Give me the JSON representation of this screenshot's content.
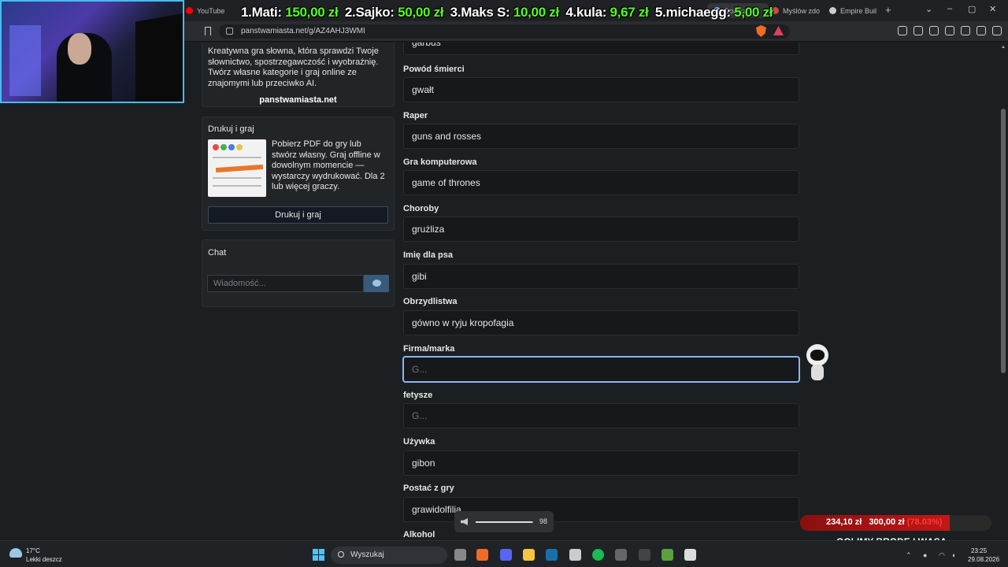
{
  "browser": {
    "tabs": [
      {
        "label": "YouTube",
        "color": "#ff0000"
      },
      {
        "label": "Dołącz",
        "color": "#8ab4f8"
      },
      {
        "label": "Myślów zdo",
        "color": "#c94b4b"
      },
      {
        "label": "Empire Buil",
        "color": "#cccccc"
      }
    ],
    "new_tab": "+",
    "url": "panstwamiasta.net/g/AZ4AHJ3WMI"
  },
  "donors": [
    {
      "rank": "1.",
      "name": "Mati:",
      "amount": "150,00 zł"
    },
    {
      "rank": "2.",
      "name": "Sajko:",
      "amount": "50,00 zł"
    },
    {
      "rank": "3.",
      "name": "Maks S:",
      "amount": "10,00 zł"
    },
    {
      "rank": "4.",
      "name": "kula:",
      "amount": "9,67 zł"
    },
    {
      "rank": "5.",
      "name": "michaegg:",
      "amount": "5,00 zł"
    }
  ],
  "sidebar": {
    "about": {
      "description": "Kreatywna gra słowna, która sprawdzi Twoje słownictwo, spostrzegawczość i wyobraźnię. Twórz własne kategorie i graj online ze znajomymi lub przeciwko AI.",
      "link": "panstwamiasta.net"
    },
    "print": {
      "title": "Drukuj i graj",
      "text": "Pobierz PDF do gry lub stwórz własny. Graj offline w dowolnym momencie — wystarczy wydrukować. Dla 2 lub więcej graczy.",
      "button": "Drukuj i graj"
    },
    "chat": {
      "title": "Chat",
      "placeholder": "Wiadomość..."
    }
  },
  "form": {
    "partial_value": "garbus",
    "fields": [
      {
        "label": "Powód śmierci",
        "value": "gwałt"
      },
      {
        "label": "Raper",
        "value": "guns and rosses"
      },
      {
        "label": "Gra komputerowa",
        "value": "game of thrones"
      },
      {
        "label": "Choroby",
        "value": "grużliza"
      },
      {
        "label": "Imię dla psa",
        "value": "gibi"
      },
      {
        "label": "Obrzydlistwa",
        "value": "gówno w ryju kropofagia"
      },
      {
        "label": "Firma/marka",
        "value": "",
        "placeholder": "G..."
      },
      {
        "label": "fetysze",
        "value": "",
        "placeholder": "G..."
      },
      {
        "label": "Używka",
        "value": "gibon"
      },
      {
        "label": "Postać z gry",
        "value": "grawidolfilia"
      },
      {
        "label": "Alkohol",
        "value": ""
      }
    ]
  },
  "volume": {
    "value": "98",
    "level": 0.98
  },
  "goal": {
    "current": "234,10 zł",
    "target": "300,00 zł",
    "percent": "(78.03%)",
    "fraction": 0.7803,
    "caption": "GOLIMY BRODE I WĄSA"
  },
  "taskbar": {
    "weather_temp": "17°C",
    "weather_desc": "Lekki deszcz",
    "search": "Wyszukaj",
    "time": "23:25",
    "date": "29.08.2026",
    "apps": [
      {
        "name": "task-view-icon",
        "color": "#888888"
      },
      {
        "name": "brave-icon",
        "color": "#f06a28"
      },
      {
        "name": "discord-icon",
        "color": "#5865f2"
      },
      {
        "name": "explorer-icon",
        "color": "#f5c542"
      },
      {
        "name": "steam-icon",
        "color": "#1b6fa8"
      },
      {
        "name": "chatgpt-icon",
        "color": "#cccccc"
      },
      {
        "name": "spotify-icon",
        "color": "#1db954"
      },
      {
        "name": "obs-icon",
        "color": "#666666"
      },
      {
        "name": "terminal-icon",
        "color": "#444444"
      },
      {
        "name": "minecraft-icon",
        "color": "#5aa03c"
      },
      {
        "name": "g-hub-icon",
        "color": "#dddddd"
      }
    ]
  }
}
